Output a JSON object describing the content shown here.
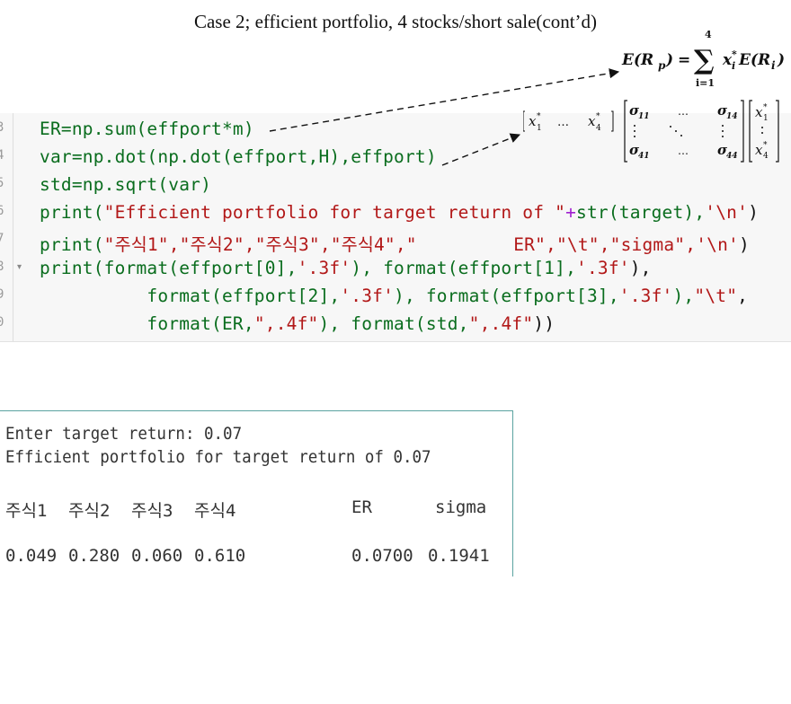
{
  "slide": {
    "title": "Case 2; efficient portfolio, 4 stocks/short sale(cont’d)"
  },
  "formulas": {
    "expected_return": {
      "lhs": "E(R",
      "lhs_sub": "p",
      "rhs_open": ")",
      "equals": "=",
      "sum": "∑",
      "upper": "4",
      "lower": "i=1",
      "term": "x",
      "term_sup": "*",
      "term_sub": "i",
      "term2": "E(R",
      "term2_sub": "i",
      "term2_close": ")"
    },
    "variance": {
      "row_vector_first": "x",
      "row_vector_last": "x",
      "sub1": "1",
      "sub4": "4",
      "sup": "*",
      "dots": "…",
      "sigma": "σ",
      "s11": "11",
      "s14": "14",
      "s41": "41",
      "s44": "44"
    }
  },
  "code": {
    "line_numbers": [
      "3",
      "4",
      "5",
      "6",
      "7",
      "8",
      "9",
      "0"
    ],
    "lines": [
      {
        "t1": "ER=np.sum(effport*m)"
      },
      {
        "t1": "var=np.dot(np.dot(effport,H),effport)"
      },
      {
        "t1": "std=np.sqrt(var)"
      },
      {
        "a": "print(",
        "b": "\"Efficient portfolio for target return of \"",
        "c": "+",
        "d": "str(target),",
        "e": "'\\n'",
        "f": ")"
      },
      {
        "a": "print(",
        "b": "\"주식1\",\"주식2\",\"주식3\",\"주식4\",\"",
        "c": "         ER\",\"\\t\",\"sigma\",",
        "d": "'\\n'",
        "e": ")"
      },
      {
        "a": "print(format(effport[0],",
        "b": "'.3f'",
        "c": "), format(effport[1],",
        "d": "'.3f'",
        "e": "),"
      },
      {
        "a": "          format(effport[2],",
        "b": "'.3f'",
        "c": "), format(effport[3],",
        "d": "'.3f'",
        "e": "),",
        "f": "\"\\t\"",
        "g": ","
      },
      {
        "a": "          format(ER,",
        "b": "\",.4f\"",
        "c": "), format(std,",
        "d": "\",.4f\"",
        "e": "))"
      }
    ]
  },
  "output": {
    "line1": "Enter target return: 0.07",
    "line2": "Efficient portfolio for target return of 0.07",
    "headers": [
      "주식1",
      "주식2",
      "주식3",
      "주식4",
      "ER",
      "sigma"
    ],
    "values": [
      "0.049",
      "0.280",
      "0.060",
      "0.610",
      "0.0700",
      "0.1941"
    ]
  },
  "colors": {
    "function": "#0a6d1e",
    "string": "#b21818",
    "operator": "#a020d0",
    "output_border": "#5aa3a0"
  }
}
